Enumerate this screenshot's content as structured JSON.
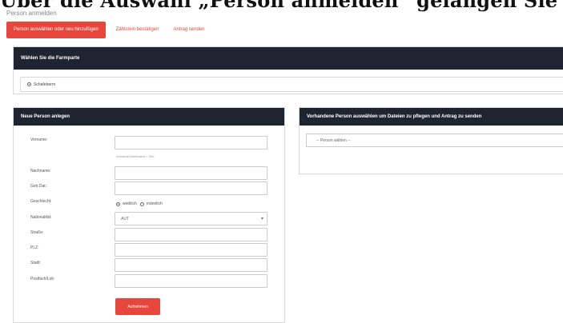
{
  "doc": {
    "heading": "Über die Auswahl „Person anmelden“ gelangen Sie z",
    "subtitle": "Person anmelden"
  },
  "tabs": [
    {
      "label": "Person auswählen oder neu hinzufügen"
    },
    {
      "label": "Zählstein bestätigen"
    },
    {
      "label": "Antrag senden"
    }
  ],
  "farmart": {
    "title": "Wählen Sie die Farmparte",
    "option": "Schafeberrn"
  },
  "new_person": {
    "title": "Neue Person anlegen",
    "fields": [
      {
        "label": "Vorname:",
        "value": ""
      },
      {
        "label": "Nachname:",
        "value": ""
      },
      {
        "label": "Geb.Dat.:",
        "value": ""
      },
      {
        "label": "Geschlecht:",
        "value": ""
      },
      {
        "label": "Nationalität:",
        "value": "AUT"
      },
      {
        "label": "Straße:",
        "value": ""
      },
      {
        "label": "PLZ:",
        "value": ""
      },
      {
        "label": "Stadt:",
        "value": ""
      },
      {
        "label": "Postfach/Lok:",
        "value": ""
      }
    ],
    "hint": "Vorname/Zweitname / Titel",
    "gender_options": [
      "weiblich",
      "männlich"
    ],
    "submit_label": "Aufnehmen"
  },
  "existing_person": {
    "title": "Vorhandene Person auswählen um Dateien zu pflegen und Antrag zu senden",
    "select_placeholder": "-- Person wählen --"
  }
}
